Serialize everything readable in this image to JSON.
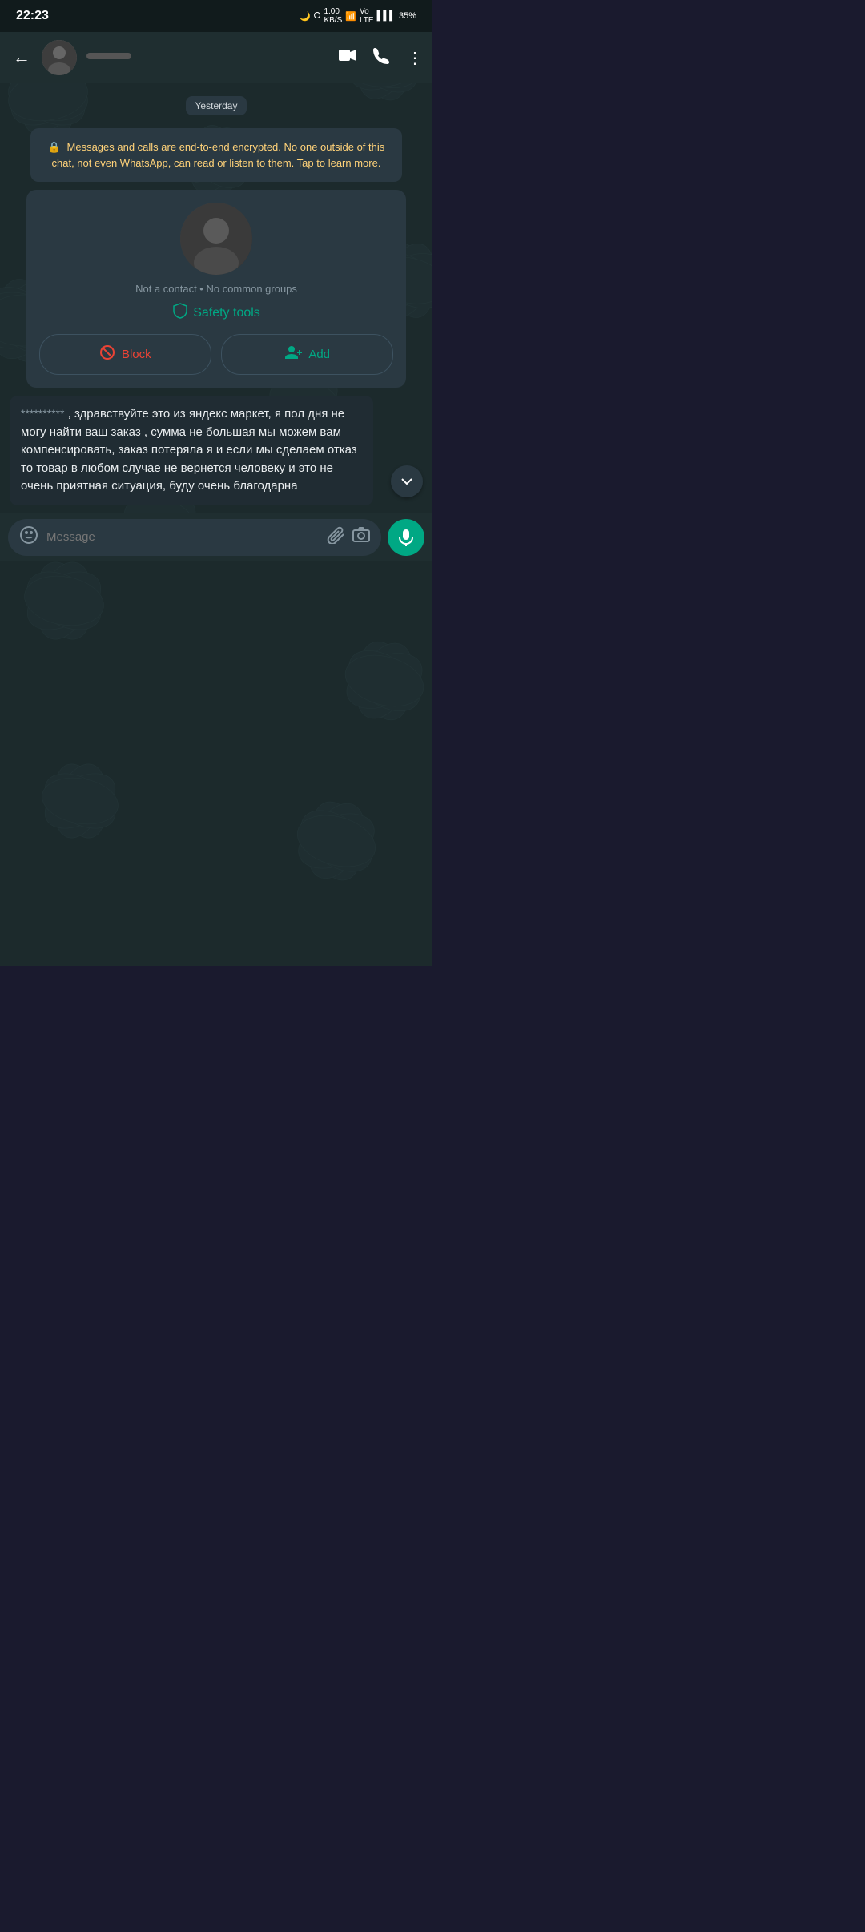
{
  "statusBar": {
    "time": "22:23",
    "battery": "35%",
    "signal": "Vo LTE"
  },
  "header": {
    "contactName": "",
    "backLabel": "←",
    "videoCallLabel": "📹",
    "phoneLabel": "📞",
    "moreLabel": "⋮"
  },
  "chat": {
    "dateDivider": "Yesterday",
    "encryptionNotice": "Messages and calls are end-to-end encrypted. No one outside of this chat, not even WhatsApp, can read or listen to them. Tap to learn more.",
    "contactStatus": "Not a contact • No common groups",
    "safetyToolsLabel": "Safety tools",
    "blockLabel": "Block",
    "addLabel": "Add",
    "messageSender": "**********",
    "messageText": ", здравствуйте это из яндекс маркет, я пол дня не могу найти ваш заказ , сумма не большая мы можем вам компенсировать, заказ потеряла я и если мы сделаем отказ то товар в любом случае не вернется человеку и это не очень приятная ситуация, буду очень благодарна"
  },
  "inputBar": {
    "placeholder": "Message",
    "emojiIcon": "emoji-icon",
    "attachIcon": "attach-icon",
    "cameraIcon": "camera-icon",
    "micIcon": "mic-icon"
  }
}
